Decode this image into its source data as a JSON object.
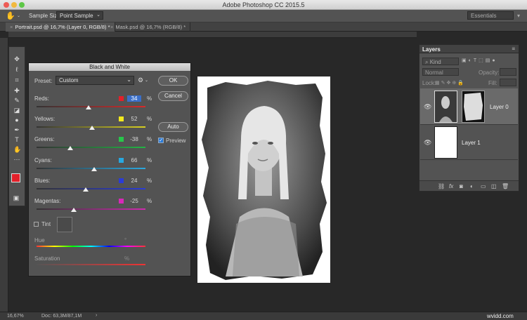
{
  "app": {
    "title": "Adobe Photoshop CC 2015.5"
  },
  "options_bar": {
    "tool_icon": "hand-tool-icon",
    "sample_size_label": "Sample Size:",
    "sample_size_value": "Point Sample",
    "workspace": "Essentials"
  },
  "doc_tabs": [
    {
      "label": "Portrait.psd @ 16,7% (Layer 0, RGB/8) *"
    },
    {
      "label": "Mask.psd @ 16,7% (RGB/8) *"
    }
  ],
  "dialog": {
    "title": "Black and White",
    "preset_label": "Preset:",
    "preset_value": "Custom",
    "channels": [
      {
        "label": "Reds:",
        "value": "34",
        "percent": "%",
        "color": "#e3202a",
        "gradient": "linear-gradient(90deg,#333,#d82a2a)",
        "level": 0.48
      },
      {
        "label": "Yellows:",
        "value": "52",
        "percent": "%",
        "color": "#f2e81e",
        "gradient": "linear-gradient(90deg,#333,#d8d020)",
        "level": 0.51
      },
      {
        "label": "Greens:",
        "value": "-38",
        "percent": "%",
        "color": "#27c64a",
        "gradient": "linear-gradient(90deg,#333,#22b544)",
        "level": 0.31
      },
      {
        "label": "Cyans:",
        "value": "66",
        "percent": "%",
        "color": "#28a8e0",
        "gradient": "linear-gradient(90deg,#333,#2aa8e0)",
        "level": 0.53
      },
      {
        "label": "Blues:",
        "value": "24",
        "percent": "%",
        "color": "#2a3cd8",
        "gradient": "linear-gradient(90deg,#333,#2a3cd8)",
        "level": 0.45
      },
      {
        "label": "Magentas:",
        "value": "-25",
        "percent": "%",
        "color": "#d828b8",
        "gradient": "linear-gradient(90deg,#333,#d02ab0)",
        "level": 0.34
      }
    ],
    "buttons": {
      "ok": "OK",
      "cancel": "Cancel",
      "auto": "Auto"
    },
    "preview_label": "Preview",
    "preview_checked": true,
    "tint_label": "Tint",
    "tint_checked": false,
    "hue_label": "Hue",
    "hue_unit": "°",
    "saturation_label": "Saturation",
    "saturation_unit": "%"
  },
  "layers_panel": {
    "title": "Layers",
    "filter_label": "Kind",
    "blend_mode": "Normal",
    "opacity_label": "Opacity:",
    "lock_label": "Lock:",
    "fill_label": "Fill:",
    "layers": [
      {
        "name": "Layer 0",
        "selected": true
      },
      {
        "name": "Layer 1",
        "selected": false
      }
    ]
  },
  "status": {
    "zoom": "16,67%",
    "doc_info": "Doc: 63,3M/87,1M"
  },
  "watermark": "wvidd.com"
}
